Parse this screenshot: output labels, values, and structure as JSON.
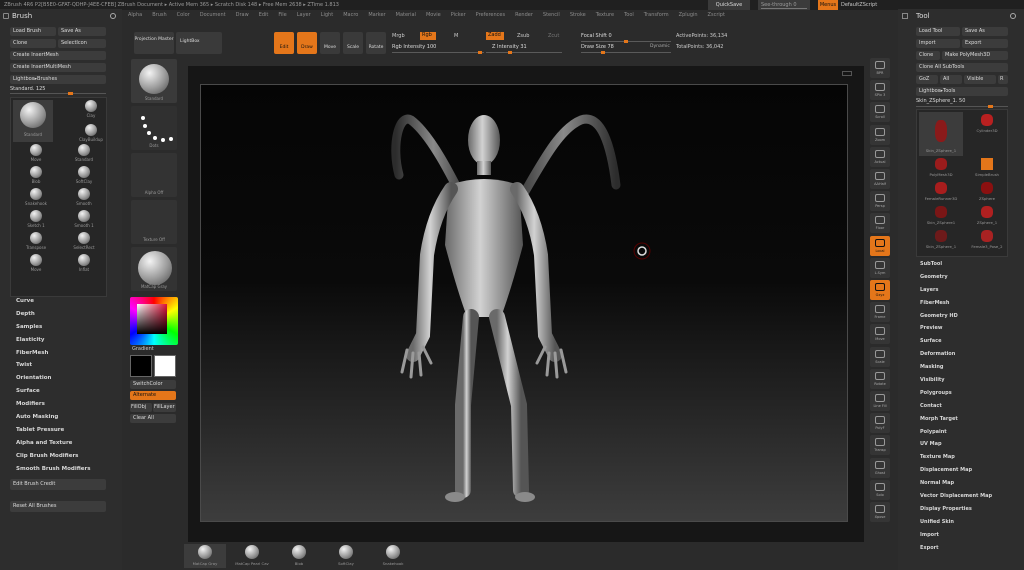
{
  "titlebar": {
    "text": "ZBrush 4R6 P2[B5E0-GFAT-QDHP-J4EE-CFEB]    ZBrush Document    ▸ Active Mem 365 ▸ Scratch Disk 148 ▸ Free Mem 2638 ▸ ZTime 1.813",
    "quicksave": "QuickSave",
    "seethrough": "See-through 0",
    "menus_btn": "Menus",
    "default_script": "DefaultZScript"
  },
  "menubar": [
    "Alpha",
    "Brush",
    "Color",
    "Document",
    "Draw",
    "Edit",
    "File",
    "Layer",
    "Light",
    "Macro",
    "Marker",
    "Material",
    "Movie",
    "Picker",
    "Preferences",
    "Render",
    "Stencil",
    "Stroke",
    "Texture",
    "Tool",
    "Transform",
    "Zplugin",
    "Zscript"
  ],
  "brush_panel": {
    "title": "Brush",
    "load_brush": "Load Brush",
    "save_as": "Save As",
    "clone": "Clone",
    "select_icon": "SelectIcon",
    "create_insertmesh": "Create InsertMesh",
    "create_insertmultimesh": "Create InsertMultiMesh",
    "lightbox_brushes": "Lightbox▸Brushes",
    "current_brush": "Standard. 125",
    "brushes": [
      "Standard",
      "Clay",
      "ClayBuildup",
      "Move",
      "Standard",
      "Blob",
      "SoftClay",
      "Snakehook",
      "Smooth",
      "Sketch 1",
      "Smooth 1",
      "Transpose",
      "SelectRect",
      "Move",
      "Inflat"
    ],
    "sections": [
      "Curve",
      "Depth",
      "Samples",
      "Elasticity",
      "FiberMesh",
      "Twist",
      "Orientation",
      "Surface",
      "Modifiers",
      "Auto Masking",
      "Tablet Pressure",
      "Alpha and Texture",
      "Clip Brush Modifiers",
      "Smooth Brush Modifiers"
    ],
    "edit_brush_credit": "Edit Brush Credit",
    "reset_all_brushes": "Reset All Brushes"
  },
  "left_shelf": {
    "labels": [
      "Standard",
      "Dots",
      "Alpha Off",
      "Texture Off",
      "MatCap Gray"
    ],
    "gradient": "Gradient",
    "switchcolor": "SwitchColor",
    "alternate": "Alternate",
    "fill_texts": [
      "FillObj",
      "FillLayer"
    ],
    "clear_all": "Clear All"
  },
  "top_toolbar": {
    "projection_master": "Projection Master",
    "lightbox": "LightBox",
    "edit": "Edit",
    "draw": "Draw",
    "move": "Move",
    "scale": "Scale",
    "rotate": "Rotate",
    "mrgb": "Mrgb",
    "rgb": "Rgb",
    "m": "M",
    "zadd": "Zadd",
    "zsub": "Zsub",
    "zcut": "Zcut",
    "rgb_intensity": "Rgb Intensity 100",
    "z_intensity": "Z Intensity 31",
    "focal_shift": "Focal Shift 0",
    "draw_size": "Draw Size 78",
    "dynamic": "Dynamic",
    "active_points": "ActivePoints: 36,134",
    "total_points": "TotalPoints: 36,042"
  },
  "right_shelf": [
    "BPR",
    "SPix 3",
    "Scroll",
    "Zoom",
    "Actual",
    "AAHalf",
    "Persp",
    "Floor",
    "Local",
    "L.Sym",
    "Gxyz",
    "Frame",
    "Move",
    "Scale",
    "Rotate",
    "Line Fill",
    "PolyF",
    "Transp",
    "Ghost",
    "Solo",
    "Xpose"
  ],
  "tool_panel": {
    "title": "Tool",
    "load_tool": "Load Tool",
    "save_as": "Save As",
    "import": "Import",
    "export": "Export",
    "clone": "Clone",
    "make_polymesh": "Make PolyMesh3D",
    "clone_all": "Clone All SubTools",
    "goz": "GoZ",
    "all": "All",
    "visible": "Visible",
    "r": "R",
    "lightbox_tools": "Lightbox▸Tools",
    "current_tool": "Skin_ZSphere_1. 50",
    "tools": [
      "Skin_ZSphere_1",
      "Cylinder3D",
      "PolyMesh3D",
      "SimpleBrush",
      "FemaleRunner3D",
      "ZSphere",
      "Skin_ZSphere1",
      "ZSphere_1",
      "Skin_ZSphere_1",
      "Female3_Pose_2"
    ],
    "sections": [
      "SubTool",
      "Geometry",
      "Layers",
      "FiberMesh",
      "Geometry HD",
      "Preview",
      "Surface",
      "Deformation",
      "Masking",
      "Visibility",
      "Polygroups",
      "Contact",
      "Morph Target",
      "Polypaint",
      "UV Map",
      "Texture Map",
      "Displacement Map",
      "Normal Map",
      "Vector Displacement Map",
      "Display Properties",
      "Unified Skin",
      "Import",
      "Export"
    ]
  },
  "bottom_shelf": [
    "MatCap Gray",
    "MatCap Pearl Cav",
    "Blob",
    "SoftClay",
    "Snakehook"
  ],
  "colors": {
    "accent": "#e4761a",
    "panel": "#2b2b2b",
    "canvas": "#0d0d0d"
  }
}
